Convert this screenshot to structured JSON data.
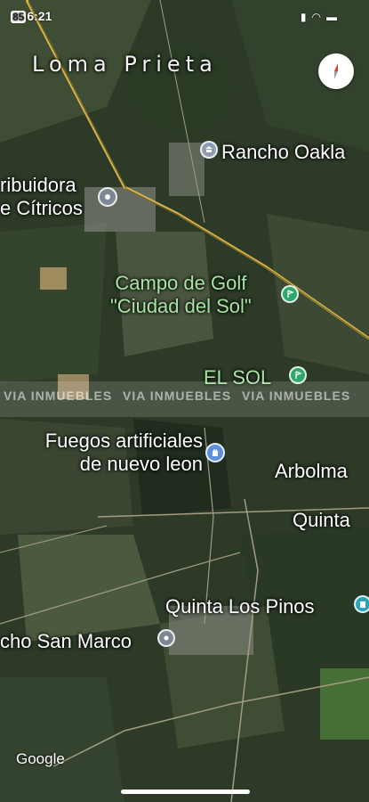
{
  "status_bar": {
    "route_shield": "85",
    "time": "6:21",
    "icons": "signal wifi battery"
  },
  "map": {
    "locality": "Loma Prieta",
    "compass": "compass-icon",
    "places": [
      {
        "id": "rancho",
        "label": "Rancho Oakla",
        "icon": "museum-icon",
        "color": "#8e9db5"
      },
      {
        "id": "distribuidora",
        "label": "ribuidora\ne Cítricos",
        "icon": "shopping-icon",
        "color": "#7d8796"
      },
      {
        "id": "golf",
        "label": "Campo de Golf\n\"Ciudad del Sol\"",
        "icon": "golf-icon",
        "color": "#2ea86a"
      },
      {
        "id": "elsol",
        "label": "EL SOL",
        "icon": "golf-icon",
        "color": "#2ea86a"
      },
      {
        "id": "fuegos",
        "label": "Fuegos artificiales\nde nuevo leon",
        "icon": "shopping-bag-icon",
        "color": "#5c8fe0"
      },
      {
        "id": "arbolma",
        "label": "Arbolma",
        "icon": "",
        "color": ""
      },
      {
        "id": "quinta",
        "label": "Quinta",
        "icon": "",
        "color": ""
      },
      {
        "id": "pinos",
        "label": "Quinta Los Pinos",
        "icon": "building-icon",
        "color": "#2aa3b8"
      },
      {
        "id": "marco",
        "label": "cho San Marco",
        "icon": "location-pin-icon",
        "color": "#7d8796"
      }
    ],
    "watermark": "VIA INMUEBLES",
    "attribution": "Google"
  }
}
